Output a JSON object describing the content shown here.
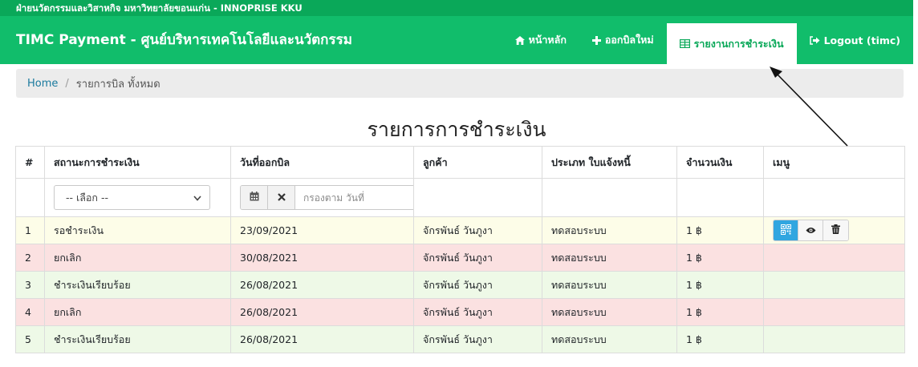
{
  "top_strip": {
    "text": "ฝ่ายนวัตกรรมและวิสาหกิจ มหาวิทยาลัยขอนแก่น - INNOPRISE KKU"
  },
  "navbar": {
    "brand": "TIMC Payment - ศูนย์บริหารเทคโนโลยีและนวัตกรรม",
    "items": [
      {
        "label": "หน้าหลัก",
        "icon": "home-icon"
      },
      {
        "label": "ออกบิลใหม่",
        "icon": "plus-icon"
      },
      {
        "label": "รายงานการชำระเงิน",
        "icon": "table-icon",
        "active": true
      },
      {
        "label": "Logout (timc)",
        "icon": "sign-out-icon"
      }
    ]
  },
  "breadcrumb": {
    "home": "Home",
    "separator": "/",
    "current": "รายการบิล ทั้งหมด"
  },
  "page_title": "รายการการชำระเงิน",
  "table": {
    "headers": [
      "#",
      "สถานะการชำระเงิน",
      "วันที่ออกบิล",
      "ลูกค้า",
      "ประเภท ใบแจ้งหนี้",
      "จำนวนเงิน",
      "เมนู"
    ],
    "filters": {
      "status_select": "-- เลือก --",
      "date_placeholder": "กรองตาม วันที่"
    },
    "rows": [
      {
        "no": "1",
        "status": "รอชำระเงิน",
        "date": "23/09/2021",
        "customer": "จักรพันธ์ วันภูงา",
        "type": "ทดสอบระบบ",
        "amount": "1 ฿",
        "state": "waiting"
      },
      {
        "no": "2",
        "status": "ยกเลิก",
        "date": "30/08/2021",
        "customer": "จักรพันธ์ วันภูงา",
        "type": "ทดสอบระบบ",
        "amount": "1 ฿",
        "state": "cancel"
      },
      {
        "no": "3",
        "status": "ชำระเงินเรียบร้อย",
        "date": "26/08/2021",
        "customer": "จักรพันธ์ วันภูงา",
        "type": "ทดสอบระบบ",
        "amount": "1 ฿",
        "state": "paid"
      },
      {
        "no": "4",
        "status": "ยกเลิก",
        "date": "26/08/2021",
        "customer": "จักรพันธ์ วันภูงา",
        "type": "ทดสอบระบบ",
        "amount": "1 ฿",
        "state": "cancel"
      },
      {
        "no": "5",
        "status": "ชำระเงินเรียบร้อย",
        "date": "26/08/2021",
        "customer": "จักรพันธ์ วันภูงา",
        "type": "ทดสอบระบบ",
        "amount": "1 ฿",
        "state": "paid"
      }
    ],
    "row_actions": [
      "qr-code-icon",
      "eye-icon",
      "trash-icon"
    ]
  },
  "colors": {
    "navbar": "#11bd6b",
    "top_strip": "#0aa859",
    "status_waiting": "#fdfde8",
    "status_cancel": "#fbe1e1",
    "status_paid": "#eef9e7",
    "qr_button": "#31a6e0"
  }
}
